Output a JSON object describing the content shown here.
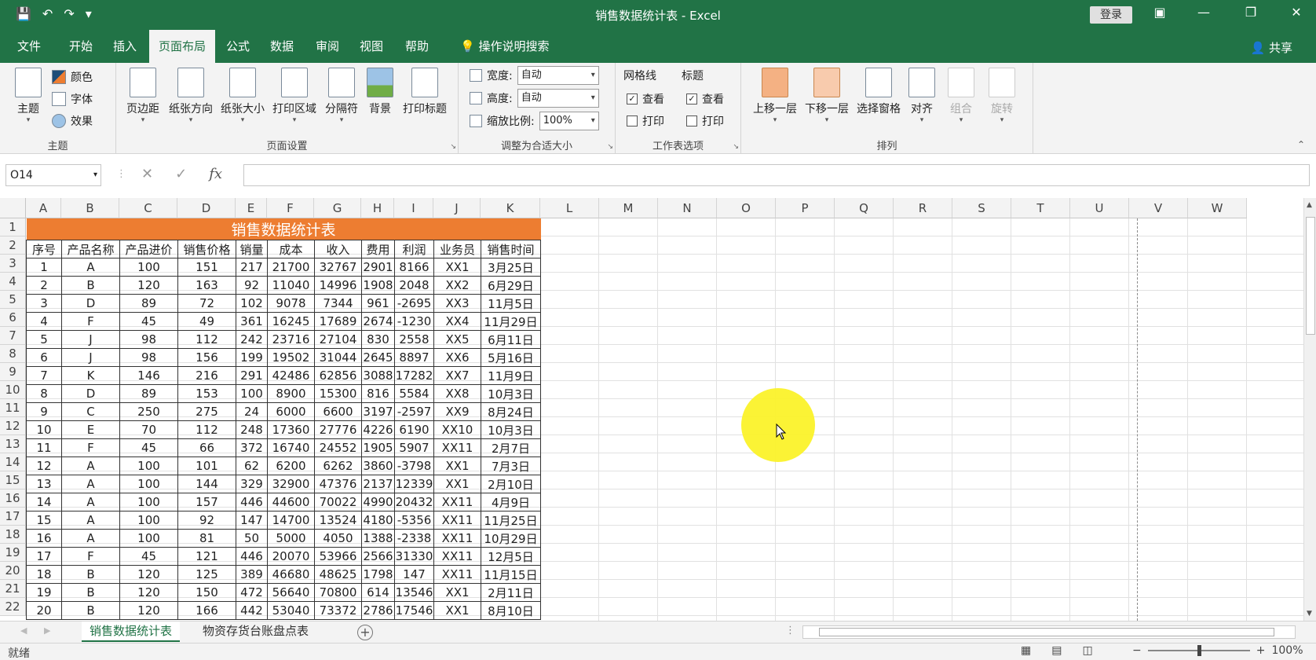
{
  "window": {
    "title": "销售数据统计表  -  Excel",
    "login_label": "登录"
  },
  "tabs": [
    "文件",
    "开始",
    "插入",
    "页面布局",
    "公式",
    "数据",
    "审阅",
    "视图",
    "帮助"
  ],
  "active_tab": "页面布局",
  "tell_me": "操作说明搜索",
  "share_label": "共享",
  "ribbon": {
    "theme_group": {
      "label": "主题",
      "theme_button": "主题",
      "colors": "颜色",
      "fonts": "字体",
      "effects": "效果"
    },
    "page_setup_group": {
      "label": "页面设置",
      "margins": "页边距",
      "orientation": "纸张方向",
      "size": "纸张大小",
      "print_area": "打印区域",
      "breaks": "分隔符",
      "background": "背景",
      "print_titles": "打印标题"
    },
    "scale_group": {
      "label": "调整为合适大小",
      "width_label": "宽度:",
      "width_value": "自动",
      "height_label": "高度:",
      "height_value": "自动",
      "scale_label": "缩放比例:",
      "scale_value": "100%"
    },
    "sheet_options_group": {
      "label": "工作表选项",
      "gridlines": "网格线",
      "headings": "标题",
      "view": "查看",
      "print": "打印"
    },
    "arrange_group": {
      "label": "排列",
      "bring_forward": "上移一层",
      "send_backward": "下移一层",
      "selection_pane": "选择窗格",
      "align": "对齐",
      "group": "组合",
      "rotate": "旋转"
    }
  },
  "formula_bar": {
    "name_box": "O14",
    "fx": "fx",
    "value": ""
  },
  "columns": [
    "A",
    "B",
    "C",
    "D",
    "E",
    "F",
    "G",
    "H",
    "I",
    "J",
    "K",
    "L",
    "M",
    "N",
    "O",
    "P",
    "Q",
    "R",
    "S",
    "T",
    "U",
    "V",
    "W"
  ],
  "rows": [
    "1",
    "2",
    "3",
    "4",
    "5",
    "6",
    "7",
    "8",
    "9",
    "10",
    "11",
    "12",
    "13",
    "14",
    "15",
    "16",
    "17",
    "18",
    "19",
    "20",
    "21",
    "22"
  ],
  "sheet": {
    "title": "销售数据统计表",
    "headers": [
      "序号",
      "产品名称",
      "产品进价",
      "销售价格",
      "销量",
      "成本",
      "收入",
      "费用",
      "利润",
      "业务员",
      "销售时间"
    ],
    "data": [
      [
        "1",
        "A",
        "100",
        "151",
        "217",
        "21700",
        "32767",
        "2901",
        "8166",
        "XX1",
        "3月25日"
      ],
      [
        "2",
        "B",
        "120",
        "163",
        "92",
        "11040",
        "14996",
        "1908",
        "2048",
        "XX2",
        "6月29日"
      ],
      [
        "3",
        "D",
        "89",
        "72",
        "102",
        "9078",
        "7344",
        "961",
        "-2695",
        "XX3",
        "11月5日"
      ],
      [
        "4",
        "F",
        "45",
        "49",
        "361",
        "16245",
        "17689",
        "2674",
        "-1230",
        "XX4",
        "11月29日"
      ],
      [
        "5",
        "J",
        "98",
        "112",
        "242",
        "23716",
        "27104",
        "830",
        "2558",
        "XX5",
        "6月11日"
      ],
      [
        "6",
        "J",
        "98",
        "156",
        "199",
        "19502",
        "31044",
        "2645",
        "8897",
        "XX6",
        "5月16日"
      ],
      [
        "7",
        "K",
        "146",
        "216",
        "291",
        "42486",
        "62856",
        "3088",
        "17282",
        "XX7",
        "11月9日"
      ],
      [
        "8",
        "D",
        "89",
        "153",
        "100",
        "8900",
        "15300",
        "816",
        "5584",
        "XX8",
        "10月3日"
      ],
      [
        "9",
        "C",
        "250",
        "275",
        "24",
        "6000",
        "6600",
        "3197",
        "-2597",
        "XX9",
        "8月24日"
      ],
      [
        "10",
        "E",
        "70",
        "112",
        "248",
        "17360",
        "27776",
        "4226",
        "6190",
        "XX10",
        "10月3日"
      ],
      [
        "11",
        "F",
        "45",
        "66",
        "372",
        "16740",
        "24552",
        "1905",
        "5907",
        "XX11",
        "2月7日"
      ],
      [
        "12",
        "A",
        "100",
        "101",
        "62",
        "6200",
        "6262",
        "3860",
        "-3798",
        "XX1",
        "7月3日"
      ],
      [
        "13",
        "A",
        "100",
        "144",
        "329",
        "32900",
        "47376",
        "2137",
        "12339",
        "XX1",
        "2月10日"
      ],
      [
        "14",
        "A",
        "100",
        "157",
        "446",
        "44600",
        "70022",
        "4990",
        "20432",
        "XX11",
        "4月9日"
      ],
      [
        "15",
        "A",
        "100",
        "92",
        "147",
        "14700",
        "13524",
        "4180",
        "-5356",
        "XX11",
        "11月25日"
      ],
      [
        "16",
        "A",
        "100",
        "81",
        "50",
        "5000",
        "4050",
        "1388",
        "-2338",
        "XX11",
        "10月29日"
      ],
      [
        "17",
        "F",
        "45",
        "121",
        "446",
        "20070",
        "53966",
        "2566",
        "31330",
        "XX11",
        "12月5日"
      ],
      [
        "18",
        "B",
        "120",
        "125",
        "389",
        "46680",
        "48625",
        "1798",
        "147",
        "XX11",
        "11月15日"
      ],
      [
        "19",
        "B",
        "120",
        "150",
        "472",
        "56640",
        "70800",
        "614",
        "13546",
        "XX1",
        "2月11日"
      ],
      [
        "20",
        "B",
        "120",
        "166",
        "442",
        "53040",
        "73372",
        "2786",
        "17546",
        "XX1",
        "8月10日"
      ]
    ]
  },
  "sheet_tabs": [
    "销售数据统计表",
    "物资存货台账盘点表"
  ],
  "active_sheet": "销售数据统计表",
  "status": {
    "ready": "就绪",
    "zoom": "100%"
  },
  "colors": {
    "excel_green": "#217346",
    "title_fill": "#ed7d31",
    "cursor_highlight": "#fbf22a"
  }
}
